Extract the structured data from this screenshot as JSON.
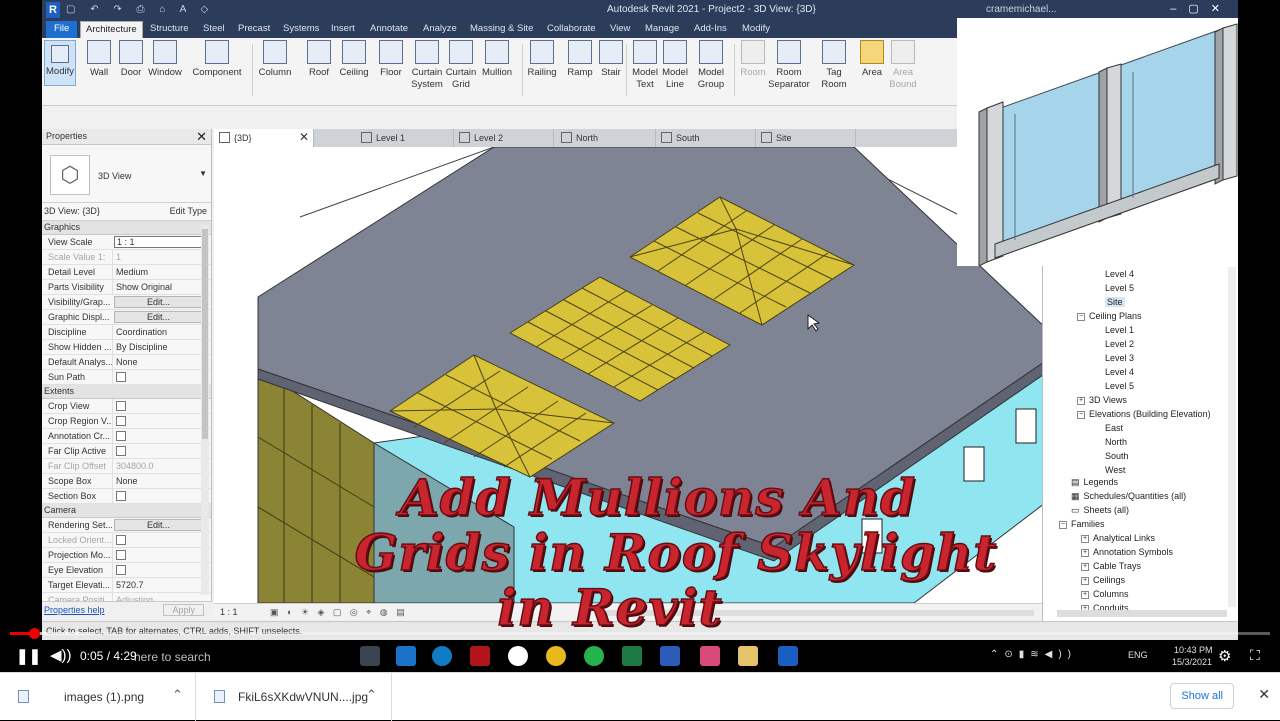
{
  "revit": {
    "app_title": "Autodesk Revit 2021 - Project2 - 3D View: {3D}",
    "user": "cramemichael...",
    "tabs": [
      {
        "label": "File"
      },
      {
        "label": "Architecture"
      },
      {
        "label": "Structure"
      },
      {
        "label": "Steel"
      },
      {
        "label": "Precast"
      },
      {
        "label": "Systems"
      },
      {
        "label": "Insert"
      },
      {
        "label": "Annotate"
      },
      {
        "label": "Analyze"
      },
      {
        "label": "Massing & Site"
      },
      {
        "label": "Collaborate"
      },
      {
        "label": "View"
      },
      {
        "label": "Manage"
      },
      {
        "label": "Add-Ins"
      },
      {
        "label": "Modify"
      }
    ],
    "ribbon": [
      {
        "label": "Modify"
      },
      {
        "label": "Wall"
      },
      {
        "label": "Door"
      },
      {
        "label": "Window"
      },
      {
        "label": "Component"
      },
      {
        "label": "Column"
      },
      {
        "label": "Roof"
      },
      {
        "label": "Ceiling"
      },
      {
        "label": "Floor"
      },
      {
        "label": "Curtain System"
      },
      {
        "label": "Curtain Grid"
      },
      {
        "label": "Mullion"
      },
      {
        "label": "Railing"
      },
      {
        "label": "Ramp"
      },
      {
        "label": "Stair"
      },
      {
        "label": "Model Text"
      },
      {
        "label": "Model Line"
      },
      {
        "label": "Model Group"
      },
      {
        "label": "Room"
      },
      {
        "label": "Room Separator"
      },
      {
        "label": "Tag Room"
      },
      {
        "label": "Area"
      },
      {
        "label": "Area Bound"
      }
    ],
    "properties": {
      "title": "Properties",
      "type_name": "3D View",
      "view_selector": "3D View: {3D}",
      "edit_type": "Edit Type",
      "groups": {
        "graphics": "Graphics",
        "extents": "Extents",
        "camera": "Camera"
      },
      "graphics_rows": [
        {
          "k": "View Scale",
          "v": "1 : 1"
        },
        {
          "k": "Scale Value    1:",
          "v": "1"
        },
        {
          "k": "Detail Level",
          "v": "Medium"
        },
        {
          "k": "Parts Visibility",
          "v": "Show Original"
        },
        {
          "k": "Visibility/Grap...",
          "v": "Edit..."
        },
        {
          "k": "Graphic Displ...",
          "v": "Edit..."
        },
        {
          "k": "Discipline",
          "v": "Coordination"
        },
        {
          "k": "Show Hidden ...",
          "v": "By Discipline"
        },
        {
          "k": "Default Analys...",
          "v": "None"
        },
        {
          "k": "Sun Path",
          "v": ""
        }
      ],
      "extents_rows": [
        {
          "k": "Crop View",
          "v": ""
        },
        {
          "k": "Crop Region V...",
          "v": ""
        },
        {
          "k": "Annotation Cr...",
          "v": ""
        },
        {
          "k": "Far Clip Active",
          "v": ""
        },
        {
          "k": "Far Clip Offset",
          "v": "304800.0"
        },
        {
          "k": "Scope Box",
          "v": "None"
        },
        {
          "k": "Section Box",
          "v": ""
        }
      ],
      "camera_rows": [
        {
          "k": "Rendering Set...",
          "v": "Edit..."
        },
        {
          "k": "Locked Orient...",
          "v": ""
        },
        {
          "k": "Projection Mo...",
          "v": ""
        },
        {
          "k": "Eye Elevation",
          "v": ""
        },
        {
          "k": "Target Elevati...",
          "v": "5720.7"
        },
        {
          "k": "Camera Positi...",
          "v": "Adjusting"
        }
      ],
      "help": "Properties help",
      "apply": "Apply"
    },
    "view_tabs": [
      {
        "label": "{3D}"
      },
      {
        "label": "Level 1"
      },
      {
        "label": "Level 2"
      },
      {
        "label": "North"
      },
      {
        "label": "South"
      },
      {
        "label": "Site"
      }
    ],
    "view_scale": "1 : 1",
    "browser": {
      "site": "Site",
      "floor_levels": [
        "Level 4",
        "Level 5"
      ],
      "ceiling_plans": "Ceiling Plans",
      "ceiling_levels": [
        "Level 1",
        "Level 2",
        "Level 3",
        "Level 4",
        "Level 5"
      ],
      "views_3d": "3D Views",
      "elevations": "Elevations (Building Elevation)",
      "elevation_items": [
        "East",
        "North",
        "South",
        "West"
      ],
      "legends": "Legends",
      "schedules": "Schedules/Quantities (all)",
      "sheets": "Sheets (all)",
      "families": "Families",
      "family_items": [
        "Analytical Links",
        "Annotation Symbols",
        "Cable Trays",
        "Ceilings",
        "Columns",
        "Conduits"
      ]
    },
    "status": "Click to select, TAB for alternates, CTRL adds, SHIFT unselects."
  },
  "caption": {
    "line1": "Add Mullions And",
    "line2": "Grids in Roof Skylight",
    "line3": "in Revit"
  },
  "player": {
    "time": "0:05 / 4:29",
    "progress_fraction": 0.019,
    "search_ghost": "here to search",
    "clock_time": "10:43 PM",
    "clock_date": "15/3/2021",
    "lang": "ENG"
  },
  "downloads": {
    "items": [
      {
        "name": "images (1).png"
      },
      {
        "name": "FkiL6sXKdwVNUN....jpg"
      }
    ],
    "show_all": "Show all"
  },
  "colors": {
    "accent_red": "#c8252f",
    "revit_blue": "#2b3d5b",
    "glass_yellow": "#d8c23a",
    "wall_cyan": "#8fe6f0",
    "roof_gray": "#7f8495"
  }
}
